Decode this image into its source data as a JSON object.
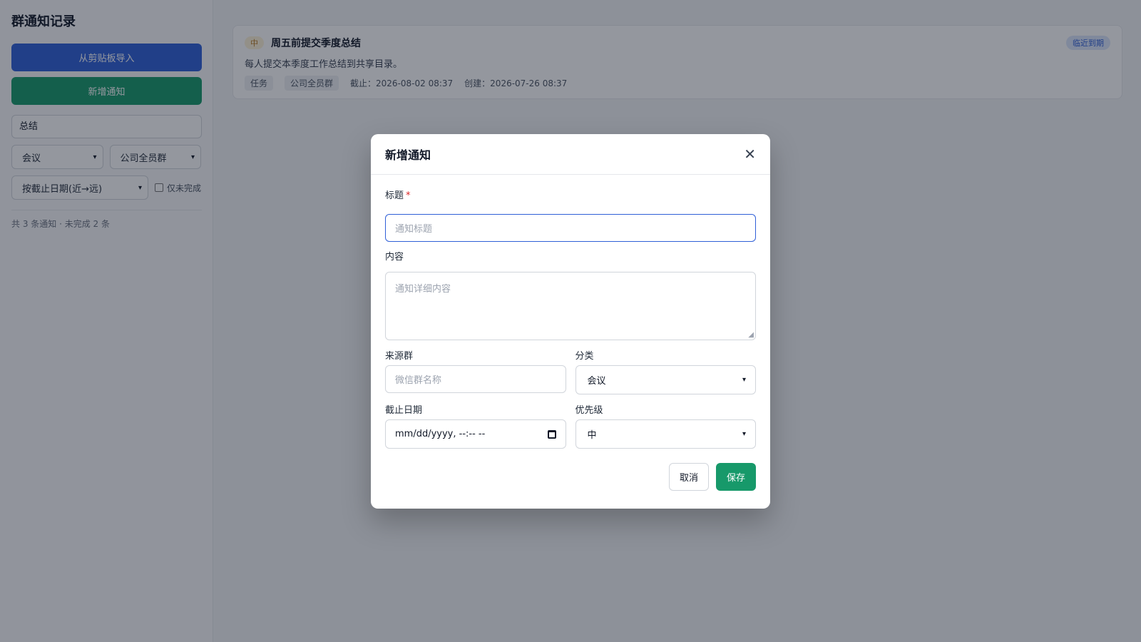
{
  "app": {
    "title": "群通知记录"
  },
  "sidebar": {
    "import_label": "从剪贴板导入",
    "add_label": "新增通知",
    "search_value": "总结",
    "filter_category": "会议",
    "filter_group": "公司全员群",
    "sort_value": "按截止日期(近→远)",
    "only_incomplete_label": "仅未完成",
    "stats": "共 3 条通知 · 未完成 2 条"
  },
  "list": {
    "items": [
      {
        "priority": "中",
        "title": "周五前提交季度总结",
        "badge": "临近到期",
        "content": "每人提交本季度工作总结到共享目录。",
        "category": "任务",
        "group": "公司全员群",
        "due": "截止：2026-08-02 08:37",
        "created": "创建：2026-07-26 08:37"
      }
    ]
  },
  "modal": {
    "title": "新增通知",
    "close_icon": "close-icon",
    "title_label": "标题",
    "required_mark": "*",
    "title_placeholder": "通知标题",
    "content_label": "内容",
    "content_placeholder": "通知详细内容",
    "group_label": "来源群",
    "group_placeholder": "微信群名称",
    "category_label": "分类",
    "category_value": "会议",
    "due_label": "截止日期",
    "due_placeholder": "mm/dd/yyyy, --:-- --",
    "priority_label": "优先级",
    "priority_value": "中",
    "cancel_label": "取消",
    "save_label": "保存"
  },
  "colors": {
    "primary_blue": "#2f5fd7",
    "primary_green": "#17996a",
    "overlay": "rgba(17,24,39,0.45)"
  }
}
